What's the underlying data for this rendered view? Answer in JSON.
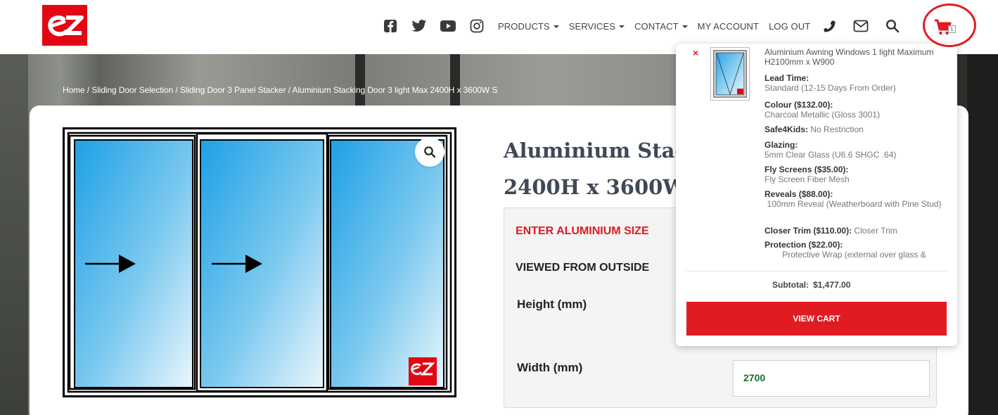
{
  "header": {
    "logo_text": "ez",
    "social": [
      "facebook-icon",
      "twitter-icon",
      "youtube-icon",
      "instagram-icon"
    ],
    "menu": [
      {
        "label": "PRODUCTS",
        "dropdown": true
      },
      {
        "label": "SERVICES",
        "dropdown": true
      },
      {
        "label": "CONTACT",
        "dropdown": true
      },
      {
        "label": "MY ACCOUNT",
        "dropdown": false
      },
      {
        "label": "LOG OUT",
        "dropdown": false
      }
    ],
    "cart_count": "1"
  },
  "breadcrumb": "Home / Sliding Door Selection / Sliding Door 3 Panel Stacker / Aluminium Stacking Door 3 light Max 2400H x 3600W S",
  "product": {
    "title_line1": "Aluminium Stac",
    "title_line2": "2400H x 3600W",
    "enter_size": "ENTER ALUMINIUM SIZE",
    "viewed_from": "VIEWED FROM OUTSIDE",
    "height_label": "Height (mm)",
    "width_label": "Width (mm)",
    "width_value": "2700"
  },
  "cart_dropdown": {
    "item_name": "Aluminium Awning Windows 1 light Maximum H2100mm x W900",
    "attributes": [
      {
        "key": "Lead Time:",
        "value": "Standard (12-15 Days From Order)",
        "block": true
      },
      {
        "key": "Colour ($132.00):",
        "value": "Charcoal Metallic (Gloss 3001)",
        "block": true
      },
      {
        "key": "Safe4Kids:",
        "value": "No Restriction",
        "block": false
      },
      {
        "key": "Glazing:",
        "value": "5mm Clear Glass (U6.6 SHGC .64)",
        "block": true
      },
      {
        "key": "Fly Screens ($35.00):",
        "value": "Fly Screen Fiber Mesh",
        "block": true
      },
      {
        "key": "Reveals ($88.00):",
        "value": "100mm Reveal (Weatherboard with Pine Stud)",
        "block": true
      },
      {
        "key": "Closer Trim ($110.00):",
        "value": "Closer Trim",
        "block": false
      },
      {
        "key": "Protection ($22.00):",
        "value": "Protective Wrap (external over glass &",
        "block": true
      }
    ],
    "subtotal_label": "Subtotal:",
    "subtotal_value": "$1,477.00",
    "view_cart_label": "VIEW CART"
  },
  "colors": {
    "brand_red": "#e11b22",
    "title_slate": "#3e4957",
    "glass_blue": "#37a9e6"
  }
}
